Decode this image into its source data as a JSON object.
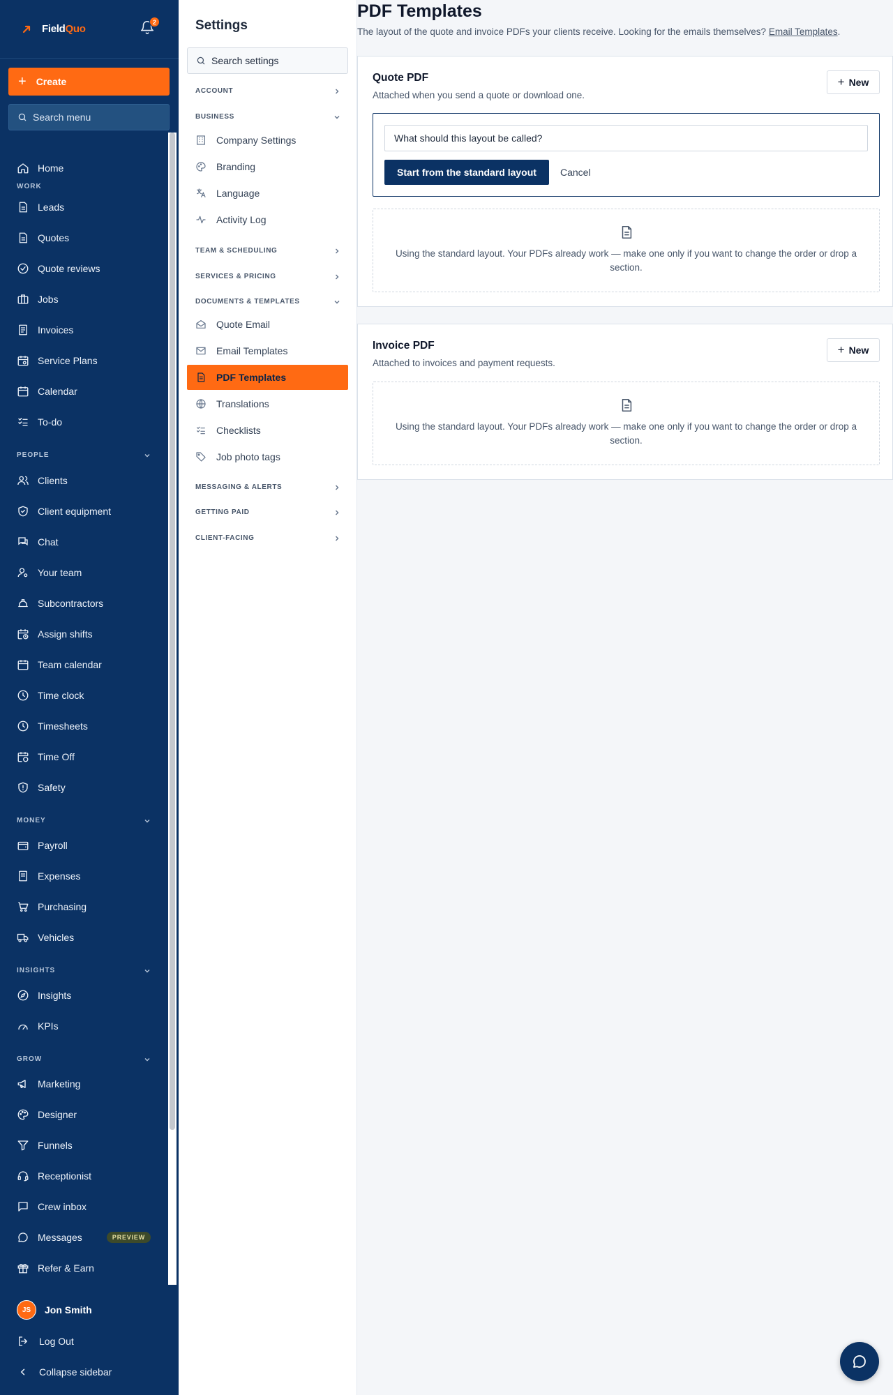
{
  "brand": {
    "name_a": "Field",
    "name_b": "Quo",
    "notifications": "2"
  },
  "sidebar": {
    "create_label": "Create",
    "search_placeholder": "Search menu",
    "home": "Home",
    "sections": {
      "work": "WORK",
      "people": "PEOPLE",
      "money": "MONEY",
      "insights": "INSIGHTS",
      "grow": "GROW"
    },
    "work_items": [
      "Leads",
      "Quotes",
      "Quote reviews",
      "Jobs",
      "Invoices",
      "Service Plans",
      "Calendar",
      "To-do"
    ],
    "people_items": [
      "Clients",
      "Client equipment",
      "Chat",
      "Your team",
      "Subcontractors",
      "Assign shifts",
      "Team calendar",
      "Time clock",
      "Timesheets",
      "Time Off",
      "Safety"
    ],
    "money_items": [
      "Payroll",
      "Expenses",
      "Purchasing",
      "Vehicles"
    ],
    "insights_items": [
      "Insights",
      "KPIs"
    ],
    "grow_items": [
      "Marketing",
      "Designer",
      "Funnels",
      "Receptionist",
      "Crew inbox",
      "Messages",
      "Refer & Earn"
    ],
    "preview_badge": "PREVIEW",
    "user_initials": "JS",
    "user_name": "Jon Smith",
    "logout": "Log Out",
    "collapse": "Collapse sidebar"
  },
  "settings": {
    "title": "Settings",
    "search_placeholder": "Search settings",
    "account": "ACCOUNT",
    "business": "BUSINESS",
    "business_items": [
      "Company Settings",
      "Branding",
      "Language",
      "Activity Log"
    ],
    "team_scheduling": "TEAM & SCHEDULING",
    "services_pricing": "SERVICES & PRICING",
    "documents_templates": "DOCUMENTS & TEMPLATES",
    "documents_items": [
      "Quote Email",
      "Email Templates",
      "PDF Templates",
      "Translations",
      "Checklists",
      "Job photo tags"
    ],
    "messaging_alerts": "MESSAGING & ALERTS",
    "getting_paid": "GETTING PAID",
    "client_facing": "CLIENT-FACING"
  },
  "main": {
    "title": "PDF Templates",
    "description": "The layout of the quote and invoice PDFs your clients receive. Looking for the emails themselves? ",
    "description_link": "Email Templates",
    "description_end": ".",
    "quote_card": {
      "title": "Quote PDF",
      "subtitle": "Attached when you send a quote or download one.",
      "new_label": "New",
      "name_placeholder": "What should this layout be called?",
      "start_label": "Start from the standard layout",
      "cancel_label": "Cancel",
      "empty_text": "Using the standard layout. Your PDFs already work — make one only if you want to change the order or drop a section."
    },
    "invoice_card": {
      "title": "Invoice PDF",
      "subtitle": "Attached to invoices and payment requests.",
      "new_label": "New",
      "empty_text": "Using the standard layout. Your PDFs already work — make one only if you want to change the order or drop a section."
    }
  },
  "colors": {
    "sidebar_bg": "#0b3264",
    "accent": "#ff6a13",
    "primary_button": "#0b3264"
  }
}
